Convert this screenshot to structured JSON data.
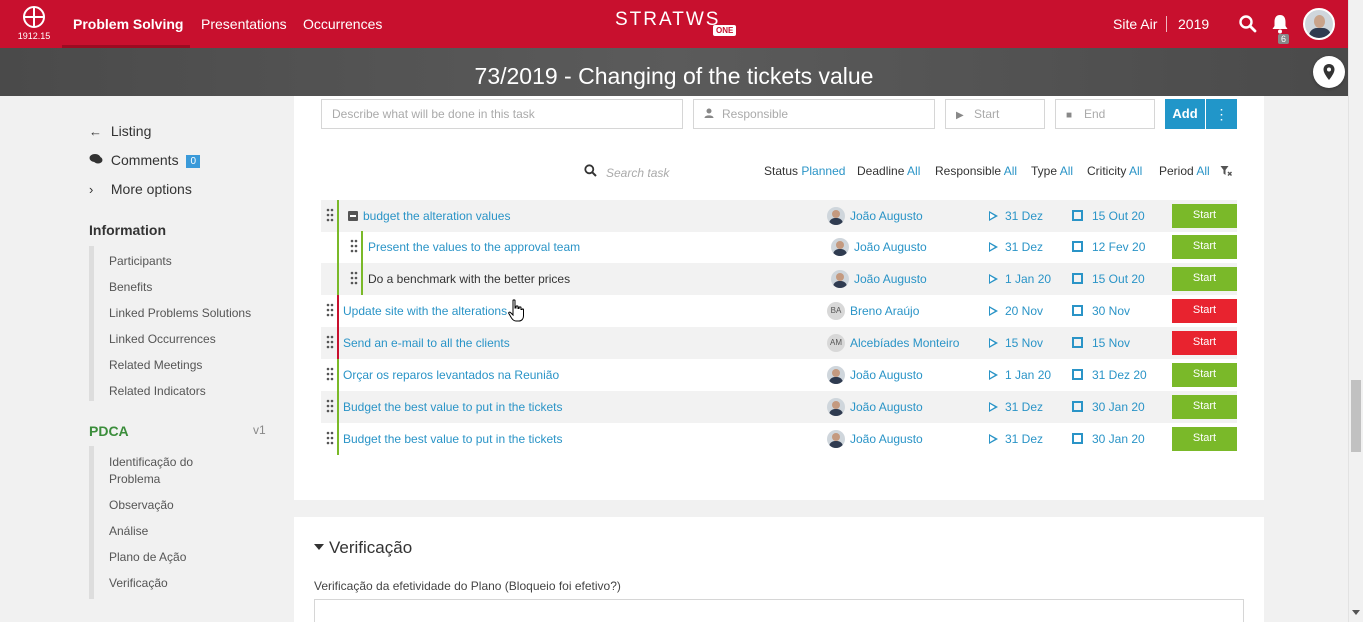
{
  "topbar": {
    "logo_text": "1912.15",
    "nav": [
      "Problem Solving",
      "Presentations",
      "Occurrences"
    ],
    "brand": "STRATWS",
    "brand_badge": "ONE",
    "site": "Site Air",
    "year": "2019",
    "notif_count": "6"
  },
  "page": {
    "title": "73/2019 - Changing of the tickets value"
  },
  "sidebar": {
    "links": [
      {
        "icon": "arrow-left-icon",
        "label": "Listing"
      },
      {
        "icon": "comments-icon",
        "label": "Comments",
        "badge": "0"
      },
      {
        "icon": "chevron-right-icon",
        "label": "More options"
      }
    ],
    "info_title": "Information",
    "info_items": [
      "Participants",
      "Benefits",
      "Linked Problems Solutions",
      "Linked Occurrences",
      "Related Meetings",
      "Related Indicators"
    ],
    "pdca_title": "PDCA",
    "pdca_version": "v1",
    "pdca_items": [
      "Identificação do",
      "Problema",
      "Observação",
      "Análise",
      "Plano de Ação",
      "Verificação"
    ]
  },
  "form": {
    "task_placeholder": "Describe what will be done in this task",
    "responsible_placeholder": "Responsible",
    "start_placeholder": "Start",
    "end_placeholder": "End",
    "add_label": "Add",
    "more_label": "⋮"
  },
  "filters": {
    "search_placeholder": "Search task",
    "status_label": "Status",
    "status_value": "Planned",
    "deadline_label": "Deadline",
    "deadline_value": "All",
    "responsible_label": "Responsible",
    "responsible_value": "All",
    "type_label": "Type",
    "type_value": "All",
    "criticity_label": "Criticity",
    "criticity_value": "All",
    "period_label": "Period",
    "period_value": "All"
  },
  "tasks": [
    {
      "name": "budget the alteration values",
      "responsible": "João Augusto",
      "avatar": "",
      "start": "31 Dez",
      "end": "15 Out 20",
      "button": "Start",
      "button_color": "#7ab929",
      "bar_color": "#7ab929"
    },
    {
      "name": "Present the values to the approval team",
      "responsible": "João Augusto",
      "avatar": "",
      "start": "31 Dez",
      "end": "12 Fev 20",
      "button": "Start",
      "button_color": "#7ab929",
      "bar_color": "#7ab929"
    },
    {
      "name": "Do a benchmark with the better prices",
      "responsible": "João Augusto",
      "avatar": "",
      "start": "1 Jan 20",
      "end": "15 Out 20",
      "button": "Start",
      "button_color": "#7ab929",
      "bar_color": "#7ab929"
    },
    {
      "name": "Update site with the alterations",
      "responsible": "Breno Araújo",
      "avatar": "BA",
      "start": "20 Nov",
      "end": "30 Nov",
      "button": "Start",
      "button_color": "#e8232f",
      "bar_color": "#c8102e"
    },
    {
      "name": "Send an e-mail to all the clients",
      "responsible": "Alcebíades Monteiro",
      "avatar": "AM",
      "start": "15 Nov",
      "end": "15 Nov",
      "button": "Start",
      "button_color": "#e8232f",
      "bar_color": "#c8102e"
    },
    {
      "name": "Orçar os reparos levantados na Reunião",
      "responsible": "João Augusto",
      "avatar": "",
      "start": "1 Jan 20",
      "end": "31 Dez 20",
      "button": "Start",
      "button_color": "#7ab929",
      "bar_color": "#7ab929"
    },
    {
      "name": "Budget the best value to put in the tickets",
      "responsible": "João Augusto",
      "avatar": "",
      "start": "31 Dez",
      "end": "30 Jan 20",
      "button": "Start",
      "button_color": "#7ab929",
      "bar_color": "#7ab929"
    },
    {
      "name": "Budget the best value to put in the tickets",
      "responsible": "João Augusto",
      "avatar": "",
      "start": "31 Dez",
      "end": "30 Jan 20",
      "button": "Start",
      "button_color": "#7ab929",
      "bar_color": "#7ab929"
    }
  ],
  "verificacao": {
    "title": "Verificação",
    "question": "Verificação da efetividade do Plano (Bloqueio foi efetivo?)"
  }
}
